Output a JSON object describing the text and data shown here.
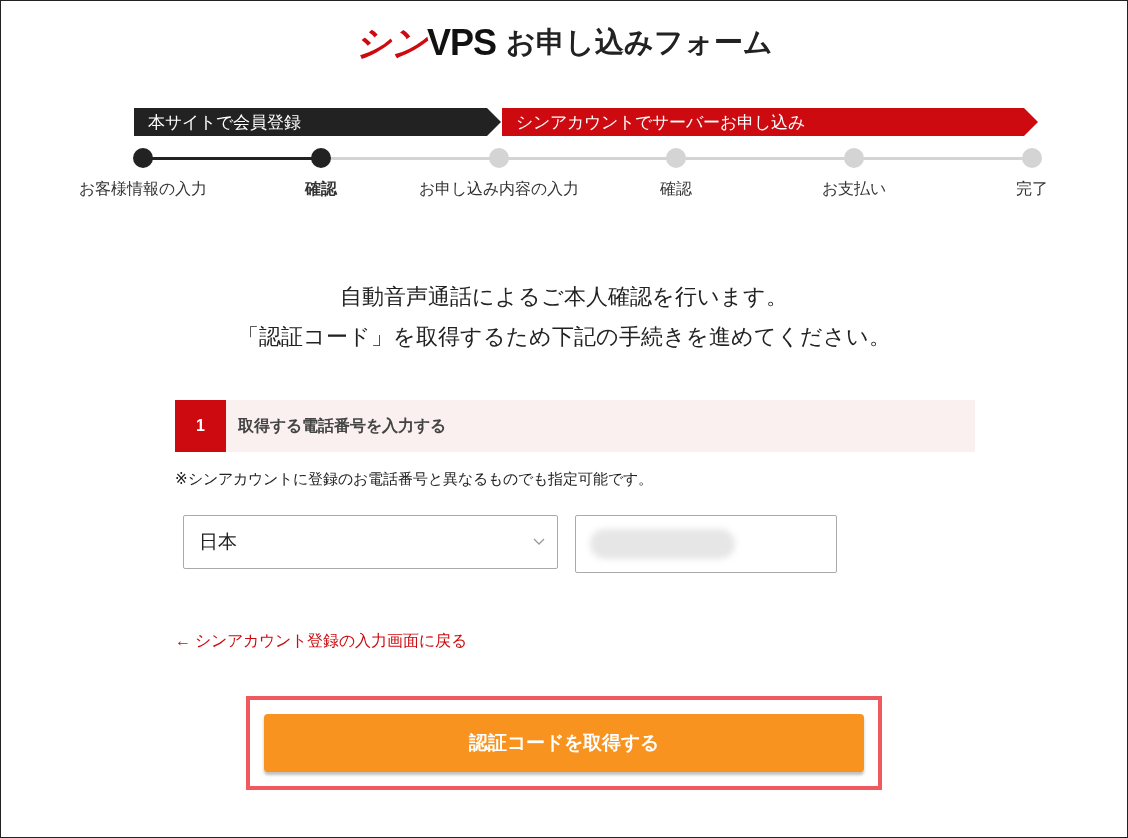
{
  "header": {
    "brand_accent": "シン",
    "brand": "VPS",
    "title": "お申し込みフォーム"
  },
  "phases": [
    {
      "label": "本サイトで会員登録",
      "color": "#222222"
    },
    {
      "label": "シンアカウントでサーバーお申し込み",
      "color": "#cc0a0f"
    }
  ],
  "steps": [
    {
      "label": "お客様情報の入力",
      "completed": true,
      "selected": false
    },
    {
      "label": "確認",
      "completed": true,
      "selected": true
    },
    {
      "label": "お申し込み内容の入力",
      "completed": false,
      "selected": false
    },
    {
      "label": "確認",
      "completed": false,
      "selected": false
    },
    {
      "label": "お支払い",
      "completed": false,
      "selected": false
    },
    {
      "label": "完了",
      "completed": false,
      "selected": false
    }
  ],
  "intro": [
    "自動音声通話によるご本人確認を行います。",
    "「認証コード」を取得するため下記の手続きを進めてください。"
  ],
  "section": {
    "number": "1",
    "title": "取得する電話番号を入力する",
    "note": "※シンアカウントに登録のお電話番号と異なるものでも指定可能です。"
  },
  "country_select": {
    "value": "日本"
  },
  "phone_field": {
    "masked": true
  },
  "back_link": {
    "arrow": "←",
    "label": "シンアカウント登録の入力画面に戻る"
  },
  "submit_button": {
    "label": "認証コードを取得する",
    "highlighted": true
  }
}
